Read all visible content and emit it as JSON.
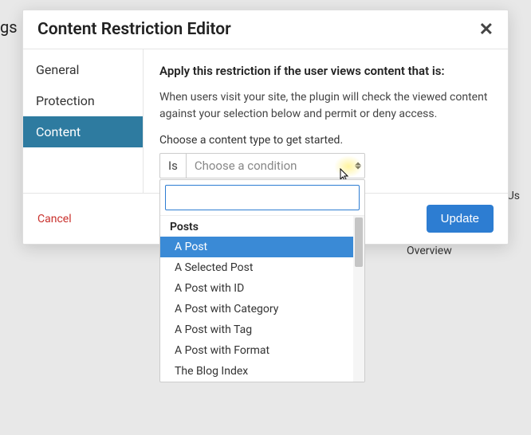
{
  "background": {
    "page_heading_fragment": "gs",
    "tab_label": "Overview",
    "right_text": "All Us"
  },
  "modal": {
    "title": "Content Restriction Editor",
    "sidebar": {
      "items": [
        {
          "label": "General"
        },
        {
          "label": "Protection"
        },
        {
          "label": "Content"
        }
      ]
    },
    "content": {
      "heading": "Apply this restriction if the user views content that is:",
      "description": "When users visit your site, the plugin will check the viewed content against your selection below and permit or deny access.",
      "prompt": "Choose a content type to get started.",
      "condition": {
        "operator": "Is",
        "placeholder": "Choose a condition"
      }
    },
    "footer": {
      "cancel": "Cancel",
      "update": "Update"
    }
  },
  "dropdown": {
    "search_value": "",
    "group_label": "Posts",
    "options": [
      {
        "label": "A Post",
        "selected": true
      },
      {
        "label": "A Selected Post",
        "selected": false
      },
      {
        "label": "A Post with ID",
        "selected": false
      },
      {
        "label": "A Post with Category",
        "selected": false
      },
      {
        "label": "A Post with Tag",
        "selected": false
      },
      {
        "label": "A Post with Format",
        "selected": false
      },
      {
        "label": "The Blog Index",
        "selected": false
      }
    ]
  }
}
